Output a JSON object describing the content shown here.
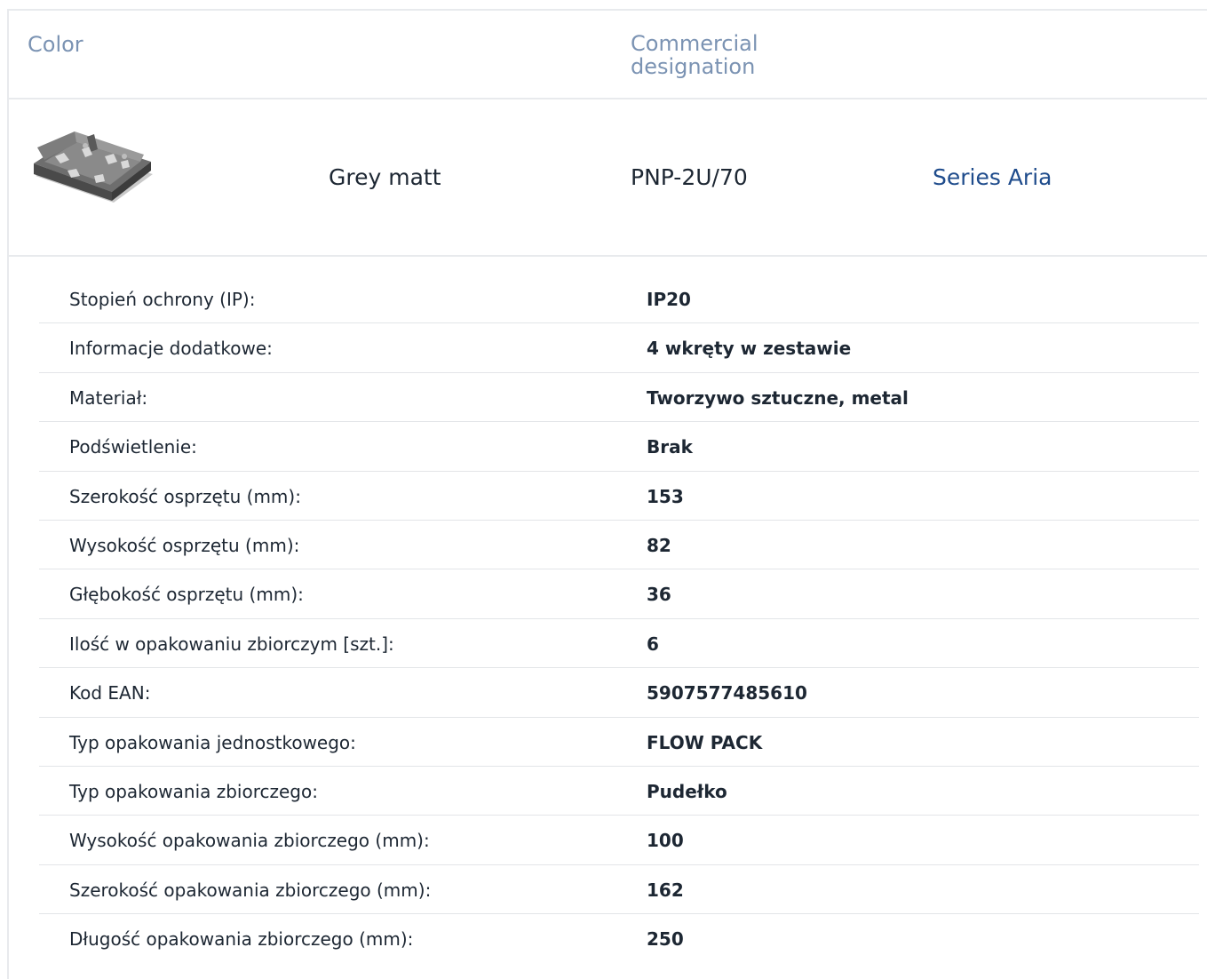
{
  "header": {
    "color_label": "Color",
    "designation_label": "Commercial designation"
  },
  "product": {
    "image_icon": "electrical-mounting-box-image",
    "color_value": "Grey matt",
    "designation_value": "PNP-2U/70",
    "series_link": "Series Aria",
    "link_color": "#1f4c8c"
  },
  "specs": [
    {
      "label": "Stopień ochrony (IP):",
      "value": "IP20"
    },
    {
      "label": "Informacje dodatkowe:",
      "value": "4 wkręty w zestawie"
    },
    {
      "label": "Materiał:",
      "value": "Tworzywo sztuczne, metal"
    },
    {
      "label": "Podświetlenie:",
      "value": "Brak"
    },
    {
      "label": "Szerokość osprzętu (mm):",
      "value": "153"
    },
    {
      "label": "Wysokość osprzętu (mm):",
      "value": "82"
    },
    {
      "label": "Głębokość osprzętu (mm):",
      "value": "36"
    },
    {
      "label": "Ilość w opakowaniu zbiorczym [szt.]:",
      "value": "6"
    },
    {
      "label": "Kod EAN:",
      "value": "5907577485610"
    },
    {
      "label": "Typ opakowania jednostkowego:",
      "value": "FLOW PACK"
    },
    {
      "label": "Typ opakowania zbiorczego:",
      "value": "Pudełko"
    },
    {
      "label": "Wysokość opakowania zbiorczego (mm):",
      "value": "100"
    },
    {
      "label": "Szerokość opakowania zbiorczego (mm):",
      "value": "162"
    },
    {
      "label": "Długość opakowania zbiorczego (mm):",
      "value": "250"
    }
  ]
}
